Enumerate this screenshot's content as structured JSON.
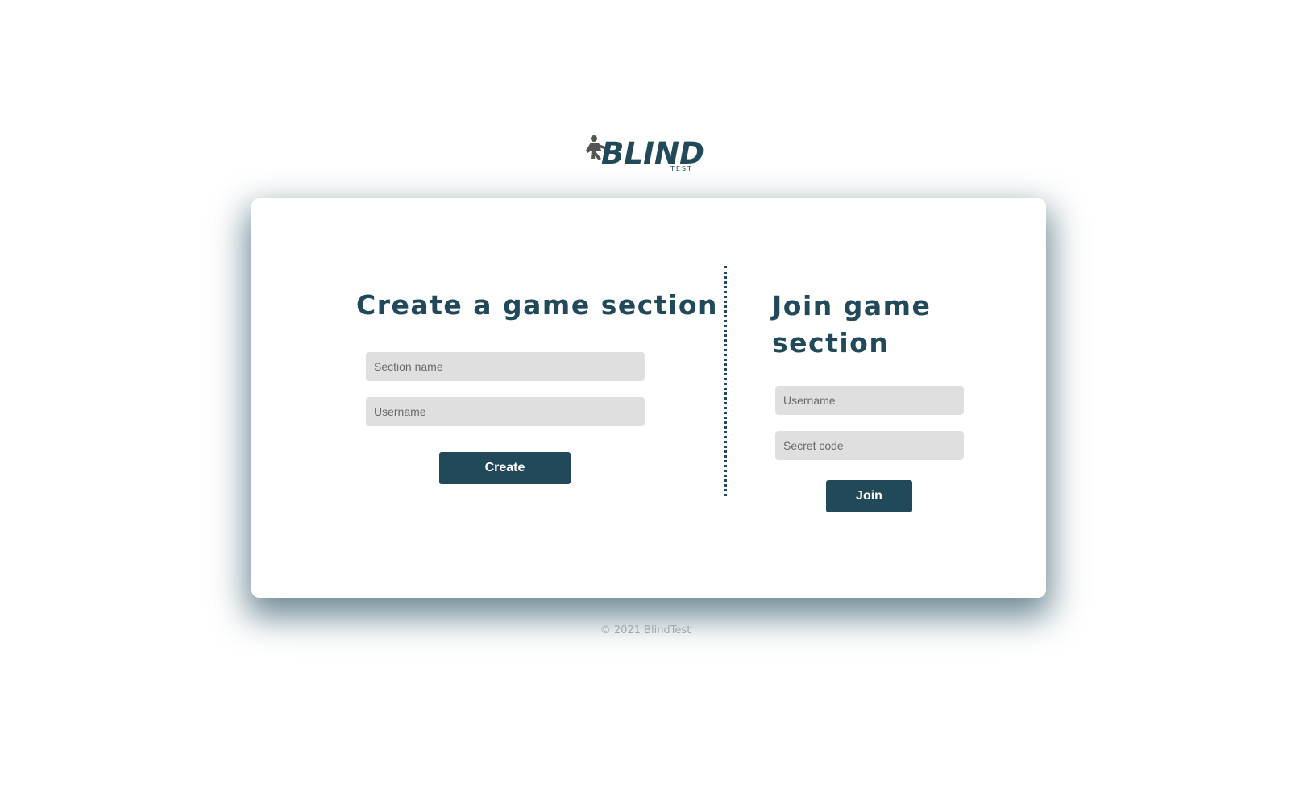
{
  "brand": {
    "logo_icon": "running-figure-icon",
    "logo_text": "BLIND",
    "logo_subtext": "TEST",
    "color": "#21495a"
  },
  "create_section": {
    "title": "Create a game section",
    "section_name_placeholder": "Section name",
    "username_placeholder": "Username",
    "button_label": "Create"
  },
  "join_section": {
    "title": "Join game section",
    "username_placeholder": "Username",
    "secret_code_placeholder": "Secret code",
    "button_label": "Join"
  },
  "footer": {
    "copyright": "© 2021 BlindTest"
  },
  "colors": {
    "accent": "#21495a",
    "input_background": "#e0dfdf",
    "footer_text": "#a4a8ab"
  }
}
